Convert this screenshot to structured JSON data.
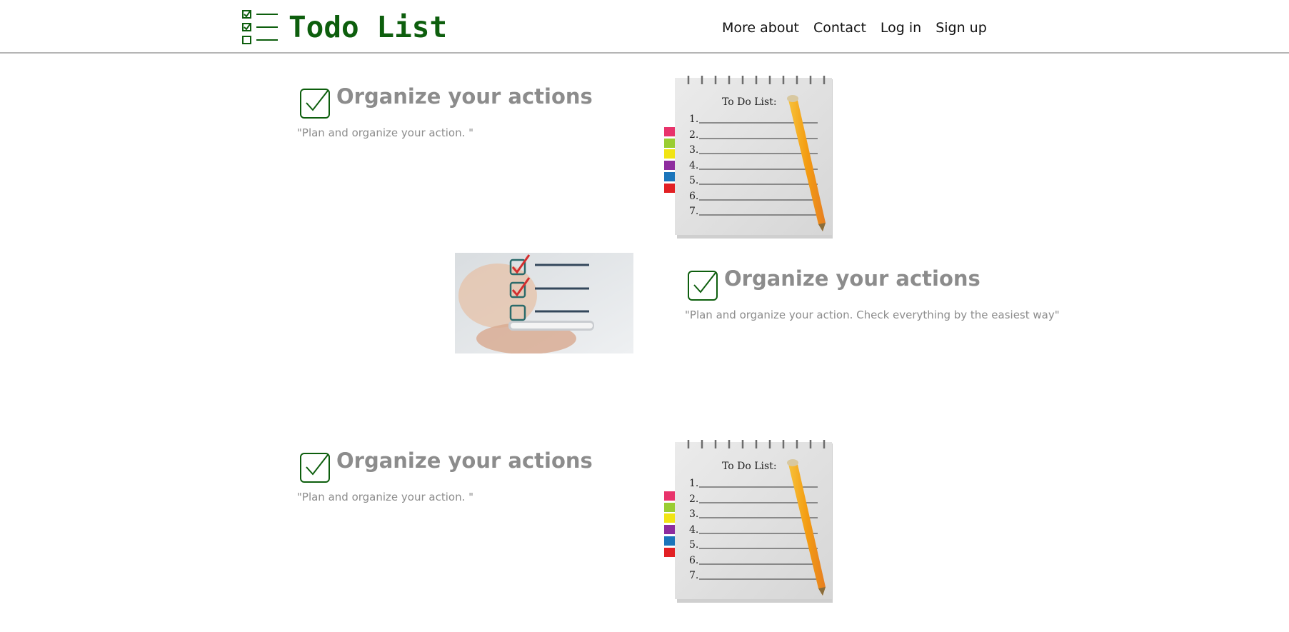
{
  "header": {
    "logo_title": "Todo List",
    "logo_icon": "checklist-icon",
    "nav": [
      "More about",
      "Contact",
      "Log in",
      "Sign up"
    ]
  },
  "features": [
    {
      "title": "Organize your actions",
      "description": "\"Plan and organize your action. \"",
      "icon": "checkbox-checked-icon",
      "image": "notepad-todo-list-image"
    },
    {
      "title": "Organize your actions",
      "description": "\"Plan and organize your action. Check everything by the easiest way\"",
      "icon": "checkbox-checked-icon",
      "image": "phone-checklist-image"
    },
    {
      "title": "Organize your actions",
      "description": "\"Plan and organize your action. \"",
      "icon": "checkbox-checked-icon",
      "image": "notepad-todo-list-image"
    }
  ],
  "notepad": {
    "heading": "To Do List:",
    "lines": [
      "1.",
      "2.",
      "3.",
      "4.",
      "5.",
      "6.",
      "7."
    ]
  },
  "colors": {
    "brand_green": "#0d5e0d",
    "feature_text": "#8c8c8c",
    "divider": "#b5b5b5"
  }
}
